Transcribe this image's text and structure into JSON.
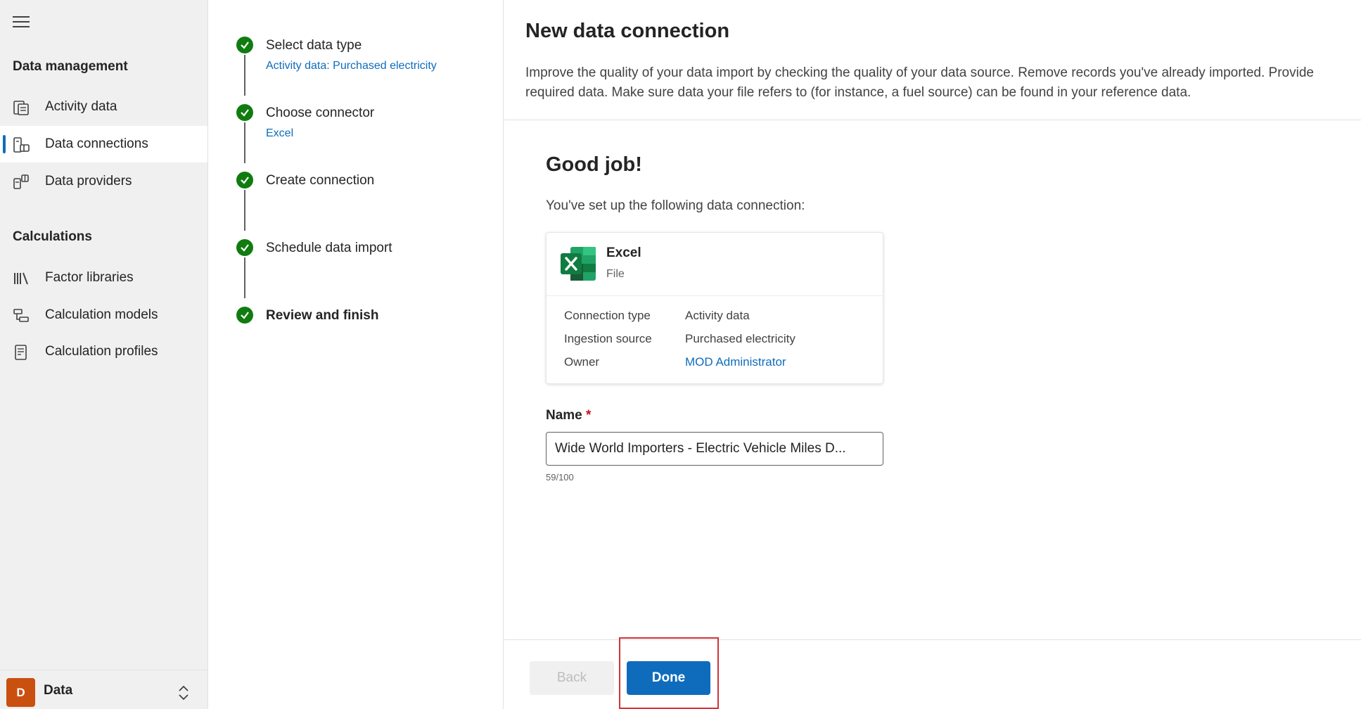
{
  "sidebar": {
    "sections": [
      {
        "title": "Data management",
        "items": [
          {
            "label": "Activity data",
            "icon": "activity-data-icon",
            "active": false
          },
          {
            "label": "Data connections",
            "icon": "data-connections-icon",
            "active": true
          },
          {
            "label": "Data providers",
            "icon": "data-providers-icon",
            "active": false
          }
        ]
      },
      {
        "title": "Calculations",
        "items": [
          {
            "label": "Factor libraries",
            "icon": "library-icon",
            "active": false
          },
          {
            "label": "Calculation models",
            "icon": "calculation-models-icon",
            "active": false
          },
          {
            "label": "Calculation profiles",
            "icon": "calculation-profiles-icon",
            "active": false
          }
        ]
      }
    ],
    "area": {
      "avatar": "D",
      "name": "Data",
      "avatar_color": "#ca5010"
    }
  },
  "stepper": {
    "steps": [
      {
        "title": "Select data type",
        "subtitle": "Activity data: Purchased electricity",
        "status": "complete"
      },
      {
        "title": "Choose connector",
        "subtitle": "Excel",
        "status": "complete"
      },
      {
        "title": "Create connection",
        "subtitle": "",
        "status": "complete"
      },
      {
        "title": "Schedule data import",
        "subtitle": "",
        "status": "complete"
      },
      {
        "title": "Review and finish",
        "subtitle": "",
        "status": "current"
      }
    ]
  },
  "main": {
    "title": "New data connection",
    "description": "Improve the quality of your data import by checking the quality of your data source. Remove records you've already imported. Provide required data. Make sure data your file refers to (for instance, a fuel source) can be found in your reference data.",
    "heading": "Good job!",
    "setup_text": "You've set up the following data connection:",
    "card": {
      "name": "Excel",
      "type": "File",
      "icon": "excel-icon",
      "rows": [
        {
          "label": "Connection type",
          "value": "Activity data"
        },
        {
          "label": "Ingestion source",
          "value": "Purchased electricity"
        },
        {
          "label": "Owner",
          "value": "MOD Administrator"
        }
      ]
    },
    "name_field": {
      "label": "Name",
      "required_marker": "*",
      "value": "Wide World Importers - Electric Vehicle Miles D...",
      "char_count": "59/100"
    },
    "buttons": {
      "back": "Back",
      "done": "Done"
    }
  },
  "colors": {
    "accent": "#0f6cbd",
    "success": "#107c10",
    "highlight": "#d13438"
  }
}
